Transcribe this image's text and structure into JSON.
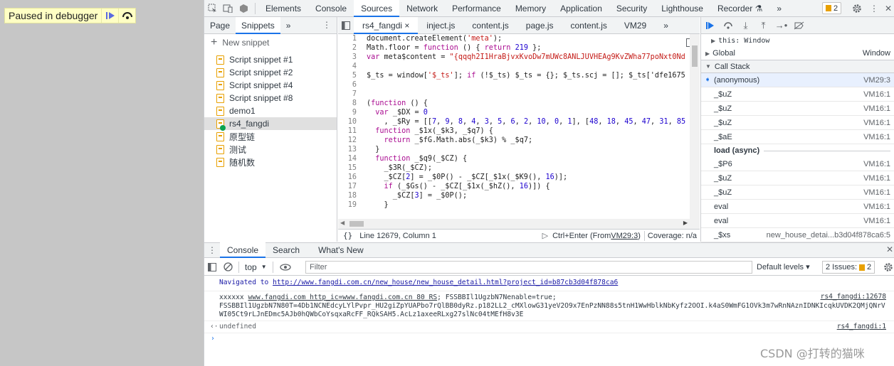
{
  "page": {
    "paused_text": "Paused in debugger"
  },
  "topbar": {
    "tabs": [
      "Elements",
      "Console",
      "Sources",
      "Network",
      "Performance",
      "Memory",
      "Application",
      "Security",
      "Lighthouse",
      "Recorder"
    ],
    "selected": "Sources",
    "more": "»",
    "issues_count": "2"
  },
  "navigator": {
    "tabs": [
      "Page",
      "Snippets"
    ],
    "selected": "Snippets",
    "more": "»",
    "new_snippet": "New snippet",
    "items": [
      "Script snippet #1",
      "Script snippet #2",
      "Script snippet #4",
      "Script snippet #8",
      "demo1",
      "rs4_fangdi",
      "原型链",
      "测试",
      "随机数"
    ],
    "selected_item": "rs4_fangdi"
  },
  "editor": {
    "tabs": [
      "rs4_fangdi",
      "inject.js",
      "content.js",
      "page.js",
      "content.js",
      "VM29"
    ],
    "selected": "rs4_fangdi",
    "close": "×",
    "more": "»",
    "lines": [
      {
        "n": "1",
        "t": "document.createElement('meta');"
      },
      {
        "n": "2",
        "t": "Math.floor = function () { return 219 };"
      },
      {
        "n": "3",
        "t": "var meta$content = \"{qqqh2I1HraBjvxKvoDw7mUWc8ANLJUVHEAg9KvZWha77poNxt0Nd"
      },
      {
        "n": "4",
        "t": ""
      },
      {
        "n": "5",
        "t": "$_ts = window['$_ts']; if (!$_ts) $_ts = {}; $_ts.scj = []; $_ts['dfe1675"
      },
      {
        "n": "6",
        "t": ""
      },
      {
        "n": "7",
        "t": ""
      },
      {
        "n": "8",
        "t": "(function () {"
      },
      {
        "n": "9",
        "t": "  var _$DX = 0"
      },
      {
        "n": "10",
        "t": "    , _$Ry = [[7, 9, 8, 4, 3, 5, 6, 2, 10, 0, 1], [48, 18, 45, 47, 31, 85"
      },
      {
        "n": "11",
        "t": "  function _$1x(_$k3, _$q7) {"
      },
      {
        "n": "12",
        "t": "    return _$fG.Math.abs(_$k3) % _$q7;"
      },
      {
        "n": "13",
        "t": "  }"
      },
      {
        "n": "14",
        "t": "  function _$q9(_$CZ) {"
      },
      {
        "n": "15",
        "t": "    _$3R(_$CZ);"
      },
      {
        "n": "16",
        "t": "    _$CZ[2] = _$0P() - _$CZ[_$1x(_$K9(), 16)];"
      },
      {
        "n": "17",
        "t": "    if (_$Gs() - _$CZ[_$1x(_$hZ(), 16)]) {"
      },
      {
        "n": "18",
        "t": "      _$CZ[3] = _$0P();"
      },
      {
        "n": "19",
        "t": "    }"
      }
    ],
    "status": {
      "position": "Line 12679, Column 1",
      "run": "Ctrl+Enter",
      "from_prefix": "(From ",
      "from_link": "VM29:3",
      "from_suffix": ")",
      "coverage": "Coverage: n/a"
    }
  },
  "debugger": {
    "scope": [
      {
        "label": "this: Window",
        "value": ""
      },
      {
        "label": "Global",
        "value": "Window"
      }
    ],
    "callstack_title": "Call Stack",
    "frames": [
      {
        "name": "(anonymous)",
        "loc": "VM29:3",
        "current": true
      },
      {
        "name": "_$uZ",
        "loc": "VM16:1"
      },
      {
        "name": "_$uZ",
        "loc": "VM16:1"
      },
      {
        "name": "_$uZ",
        "loc": "VM16:1"
      },
      {
        "name": "_$aE",
        "loc": "VM16:1"
      },
      {
        "name": "load (async)",
        "loc": "",
        "async": true
      },
      {
        "name": "_$P6",
        "loc": "VM16:1"
      },
      {
        "name": "_$uZ",
        "loc": "VM16:1"
      },
      {
        "name": "_$uZ",
        "loc": "VM16:1"
      },
      {
        "name": "eval",
        "loc": "VM16:1"
      },
      {
        "name": "eval",
        "loc": "VM16:1"
      },
      {
        "name": "_$xs",
        "loc": "new_house_detai...b3d04f878ca6:5"
      }
    ]
  },
  "console": {
    "tabs": [
      "Console",
      "Search",
      "What's New"
    ],
    "selected": "Console",
    "context": "top",
    "filter_placeholder": "Filter",
    "levels": "Default levels ▾",
    "issues": "2 Issues:",
    "issues_count": "2",
    "nav_prefix": "Navigated to ",
    "nav_url": "http://www.fangdi.com.cn/new_house/new_house_detail.html?project_id=b87cb3d04f878ca6",
    "log1_prefix": "xxxxxx ",
    "log1_link": "www.fangdi.com http_ic=www.fangdi.com.cn 80 RS",
    "log1_suffix": "; FSSBBIl1UgzbN7Nenable=true;",
    "log1_cont": "FSSBBIl1UgzbN7N80T=4Db1NCNEdcyLYlPvpr_HU2giZpYUAPbo7rQlBB0dyRz.p182LL2_cMXlowG31yeV2O9x7EnPzNN88s5tnH1WwHblkNbKyfz2OOI.k4aS0WmFG1OVk3m7wRnNAznIDNKIcqkUVDK2QMjQNrVWI05Ct9rLJnEDmc5AJb0hQWbCoYsqxaRcFF_RQkSAH5.AcLz1axeeRLxg27slNc04tMEfH8v3E",
    "log1_src": "rs4_fangdi:12678",
    "undefined": "undefined",
    "undef_src": "rs4_fangdi:1"
  },
  "watermark": "CSDN @打转的猫咪"
}
